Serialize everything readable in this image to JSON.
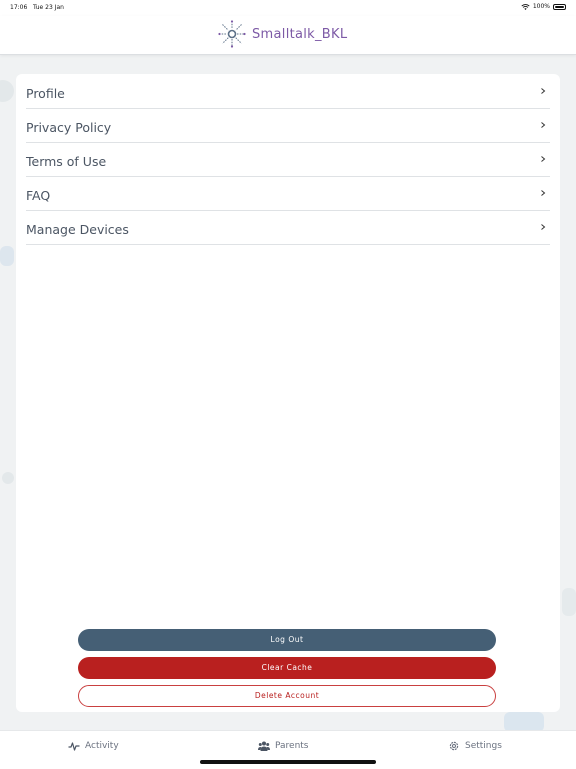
{
  "status_bar": {
    "time": "17:06",
    "date": "Tue 23 Jan",
    "battery": "100%",
    "icons": [
      "wifi-icon",
      "battery-icon"
    ]
  },
  "header": {
    "title": "Smalltalk_BKL",
    "logo_icon": "smalltalk-logo-icon",
    "title_color": "#7d5aa6"
  },
  "menu": {
    "items": [
      {
        "label": "Profile",
        "icon": "chevron-right-icon"
      },
      {
        "label": "Privacy Policy",
        "icon": "chevron-right-icon"
      },
      {
        "label": "Terms of Use",
        "icon": "chevron-right-icon"
      },
      {
        "label": "FAQ",
        "icon": "chevron-right-icon"
      },
      {
        "label": "Manage Devices",
        "icon": "chevron-right-icon"
      }
    ]
  },
  "actions": {
    "logout_label": "Log Out",
    "clear_cache_label": "Clear Cache",
    "delete_account_label": "Delete Account",
    "colors": {
      "logout": "#455f75",
      "danger": "#b9201f"
    }
  },
  "tab_bar": {
    "tabs": [
      {
        "label": "Activity",
        "icon": "activity-pulse-icon"
      },
      {
        "label": "Parents",
        "icon": "people-group-icon"
      },
      {
        "label": "Settings",
        "icon": "gear-icon"
      }
    ],
    "active_tab": "Settings"
  }
}
